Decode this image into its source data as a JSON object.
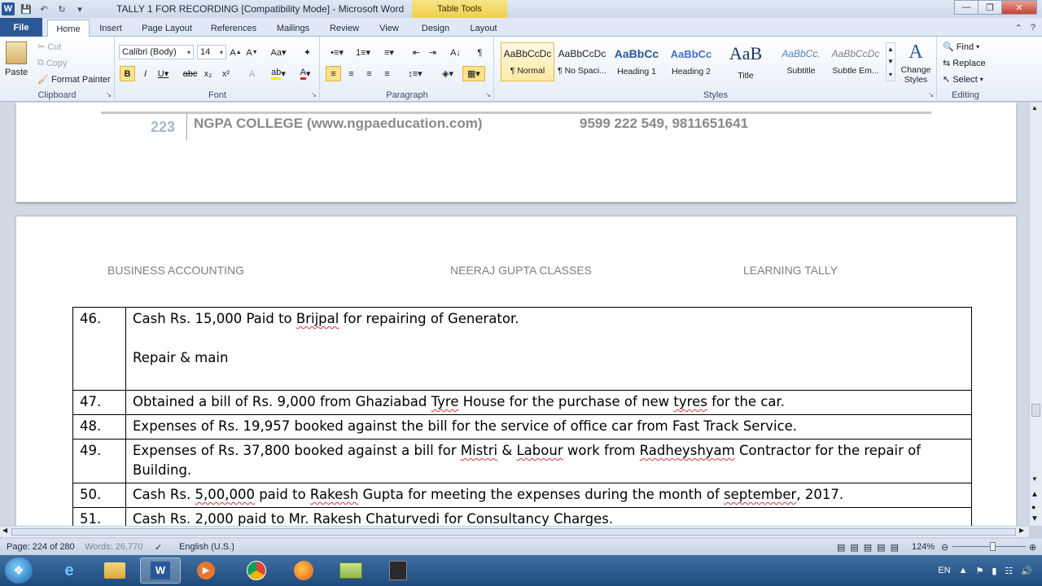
{
  "window": {
    "title": "TALLY 1 FOR RECORDING [Compatibility Mode]  -  Microsoft Word",
    "context_tab": "Table Tools"
  },
  "tabs": [
    {
      "label": "File"
    },
    {
      "label": "Home"
    },
    {
      "label": "Insert"
    },
    {
      "label": "Page Layout"
    },
    {
      "label": "References"
    },
    {
      "label": "Mailings"
    },
    {
      "label": "Review"
    },
    {
      "label": "View"
    },
    {
      "label": "Design"
    },
    {
      "label": "Layout"
    }
  ],
  "ribbon": {
    "clipboard": {
      "label": "Clipboard",
      "paste": "Paste",
      "cut": "Cut",
      "copy": "Copy",
      "format_painter": "Format Painter"
    },
    "font": {
      "label": "Font",
      "name": "Calibri (Body)",
      "size": "14"
    },
    "paragraph": {
      "label": "Paragraph"
    },
    "styles": {
      "label": "Styles",
      "items": [
        {
          "sample": "AaBbCcDc",
          "name": "¶ Normal"
        },
        {
          "sample": "AaBbCcDc",
          "name": "¶ No Spaci..."
        },
        {
          "sample": "AaBbCc",
          "name": "Heading 1"
        },
        {
          "sample": "AaBbCc",
          "name": "Heading 2"
        },
        {
          "sample": "AaB",
          "name": "Title"
        },
        {
          "sample": "AaBbCc.",
          "name": "Subtitle"
        },
        {
          "sample": "AaBbCcDc",
          "name": "Subtle Em..."
        }
      ],
      "change_styles": "Change Styles"
    },
    "editing": {
      "label": "Editing",
      "find": "Find",
      "replace": "Replace",
      "select": "Select"
    }
  },
  "document": {
    "footer": {
      "page_number": "223",
      "college": "NGPA COLLEGE (www.ngpaeducation.com)",
      "phone": "9599 222 549, 9811651641"
    },
    "header": {
      "left": "BUSINESS ACCOUNTING",
      "center": "NEERAJ GUPTA CLASSES",
      "right": "LEARNING TALLY"
    },
    "rows": [
      {
        "num": "46.",
        "parts": [
          "Cash Rs. 15,000 Paid to ",
          "Brijpal",
          " for repairing of Generator."
        ],
        "extra": "Repair & main"
      },
      {
        "num": "47.",
        "parts": [
          "Obtained a bill of Rs. 9,000 from Ghaziabad ",
          "Tyre",
          " House for the purchase of new ",
          "tyres",
          " for the car."
        ]
      },
      {
        "num": "48.",
        "parts": [
          "Expenses of Rs. 19,957 booked against the bill for the service of office car from Fast Track Service."
        ]
      },
      {
        "num": "49.",
        "parts": [
          "Expenses of Rs. 37,800 booked against a bill for ",
          "Mistri",
          " & ",
          "Labour",
          " work from ",
          "Radheyshyam",
          " Contractor for the repair of Building."
        ]
      },
      {
        "num": "50.",
        "parts": [
          "Cash Rs. ",
          "5,00,000",
          " paid to ",
          "Rakesh",
          " Gupta for meeting the expenses during the month of ",
          "september",
          ", 2017."
        ]
      },
      {
        "num": "51.",
        "parts": [
          "Cash Rs. 2,000 paid to Mr. ",
          "Rakesh",
          " ",
          "Chaturvedi",
          " for Consultancy Charges."
        ]
      }
    ]
  },
  "status": {
    "page": "Page: 224 of 280",
    "words": "Words: 26,770",
    "language": "English (U.S.)",
    "zoom": "124%",
    "zoom_fraction": 0.55
  },
  "tray": {
    "lang": "EN"
  }
}
